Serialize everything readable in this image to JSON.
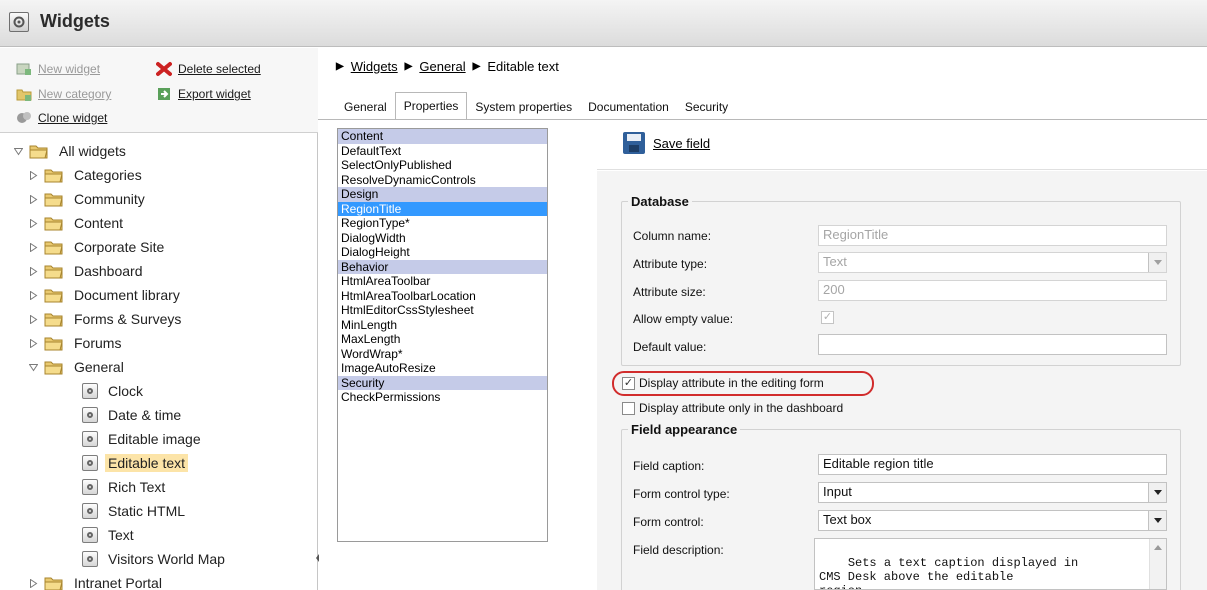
{
  "window": {
    "title": "Widgets",
    "icon": "widget-icon"
  },
  "toolbar": {
    "new_widget": "New widget",
    "new_category": "New category",
    "clone_widget": "Clone widget",
    "delete_selected": "Delete selected",
    "export_widget": "Export widget"
  },
  "tree": {
    "root": "All widgets",
    "items": [
      {
        "label": "Categories",
        "type": "folder",
        "expanded": false
      },
      {
        "label": "Community",
        "type": "folder",
        "expanded": false
      },
      {
        "label": "Content",
        "type": "folder",
        "expanded": false
      },
      {
        "label": "Corporate Site",
        "type": "folder",
        "expanded": false
      },
      {
        "label": "Dashboard",
        "type": "folder",
        "expanded": false
      },
      {
        "label": "Document library",
        "type": "folder",
        "expanded": false
      },
      {
        "label": "Forms & Surveys",
        "type": "folder",
        "expanded": false
      },
      {
        "label": "Forums",
        "type": "folder",
        "expanded": false
      },
      {
        "label": "General",
        "type": "folder",
        "expanded": true
      },
      {
        "label": "Clock",
        "type": "widget"
      },
      {
        "label": "Date & time",
        "type": "widget"
      },
      {
        "label": "Editable image",
        "type": "widget"
      },
      {
        "label": "Editable text",
        "type": "widget",
        "selected": true
      },
      {
        "label": "Rich Text",
        "type": "widget"
      },
      {
        "label": "Static HTML",
        "type": "widget"
      },
      {
        "label": "Text",
        "type": "widget"
      },
      {
        "label": "Visitors World Map",
        "type": "widget"
      },
      {
        "label": "Intranet Portal",
        "type": "folder",
        "expanded": false
      }
    ]
  },
  "breadcrumb": {
    "items": [
      "Widgets",
      "General"
    ],
    "current": "Editable text"
  },
  "tabs": [
    {
      "label": "General",
      "active": false
    },
    {
      "label": "Properties",
      "active": true
    },
    {
      "label": "System properties",
      "active": false
    },
    {
      "label": "Documentation",
      "active": false
    },
    {
      "label": "Security",
      "active": false
    }
  ],
  "fields": [
    {
      "label": "Content",
      "kind": "category"
    },
    {
      "label": "DefaultText",
      "kind": "field"
    },
    {
      "label": "SelectOnlyPublished",
      "kind": "field"
    },
    {
      "label": "ResolveDynamicControls",
      "kind": "field"
    },
    {
      "label": "Design",
      "kind": "category"
    },
    {
      "label": "RegionTitle",
      "kind": "selected"
    },
    {
      "label": "RegionType*",
      "kind": "field"
    },
    {
      "label": "DialogWidth",
      "kind": "field"
    },
    {
      "label": "DialogHeight",
      "kind": "field"
    },
    {
      "label": "Behavior",
      "kind": "category"
    },
    {
      "label": "HtmlAreaToolbar",
      "kind": "field"
    },
    {
      "label": "HtmlAreaToolbarLocation",
      "kind": "field"
    },
    {
      "label": "HtmlEditorCssStylesheet",
      "kind": "field"
    },
    {
      "label": "MinLength",
      "kind": "field"
    },
    {
      "label": "MaxLength",
      "kind": "field"
    },
    {
      "label": "WordWrap*",
      "kind": "field"
    },
    {
      "label": "ImageAutoResize",
      "kind": "field"
    },
    {
      "label": "Security",
      "kind": "category"
    },
    {
      "label": "CheckPermissions",
      "kind": "field"
    }
  ],
  "props": {
    "save_label": "Save field",
    "database": {
      "legend": "Database",
      "column_name_label": "Column name:",
      "column_name_value": "RegionTitle",
      "attribute_type_label": "Attribute type:",
      "attribute_type_value": "Text",
      "attribute_size_label": "Attribute size:",
      "attribute_size_value": "200",
      "allow_empty_label": "Allow empty value:",
      "default_value_label": "Default value:",
      "default_value_value": ""
    },
    "display_in_form_label": "Display attribute in the editing form",
    "display_in_dashboard_label": "Display attribute only in the dashboard",
    "appearance": {
      "legend": "Field appearance",
      "caption_label": "Field caption:",
      "caption_value": "Editable region title",
      "control_type_label": "Form control type:",
      "control_type_value": "Input",
      "form_control_label": "Form control:",
      "form_control_value": "Text box",
      "description_label": "Field description:",
      "description_value": "Sets a text caption displayed in\nCMS Desk above the editable\nregion."
    }
  },
  "colors": {
    "highlight": "#d12c2c",
    "selected_field": "#3399ff",
    "category_bg": "#c5cbe8",
    "selected_tree": "#fce4a8"
  }
}
